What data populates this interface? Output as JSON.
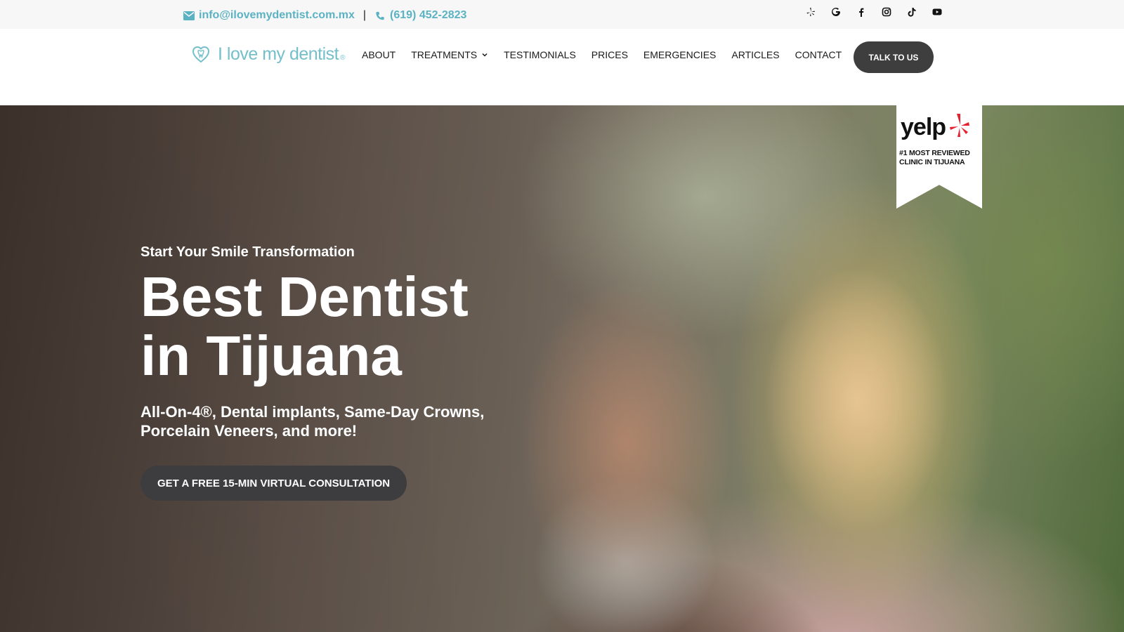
{
  "topbar": {
    "email": "info@ilovemydentist.com.mx",
    "separator": "|",
    "phone": "(619) 452-2823",
    "social_icons": [
      "yelp-icon",
      "google-icon",
      "facebook-icon",
      "instagram-icon",
      "tiktok-icon",
      "youtube-icon"
    ]
  },
  "header": {
    "logo_text": "I love my dentist",
    "logo_mark": "®",
    "nav": [
      {
        "label": "ABOUT"
      },
      {
        "label": "TREATMENTS"
      },
      {
        "label": "TESTIMONIALS"
      },
      {
        "label": "PRICES"
      },
      {
        "label": "EMERGENCIES"
      },
      {
        "label": "ARTICLES"
      },
      {
        "label": "CONTACT"
      }
    ],
    "cta_label": "TALK TO US"
  },
  "hero": {
    "eyebrow": "Start Your Smile Transformation",
    "title_line1": "Best Dentist",
    "title_line2": "in Tijuana",
    "subtitle": "All-On-4®, Dental implants, Same-Day Crowns, Porcelain Veneers, and more!",
    "cta_label": "GET A FREE 15-MIN VIRTUAL CONSULTATION"
  },
  "badge": {
    "brand": "yelp",
    "line1": "#1 MOST REVIEWED",
    "line2": "CLINIC IN TIJUANA"
  },
  "colors": {
    "accent": "#5bb2c3",
    "button_dark": "#3e3e3f",
    "yelp_red": "#e6202e"
  }
}
